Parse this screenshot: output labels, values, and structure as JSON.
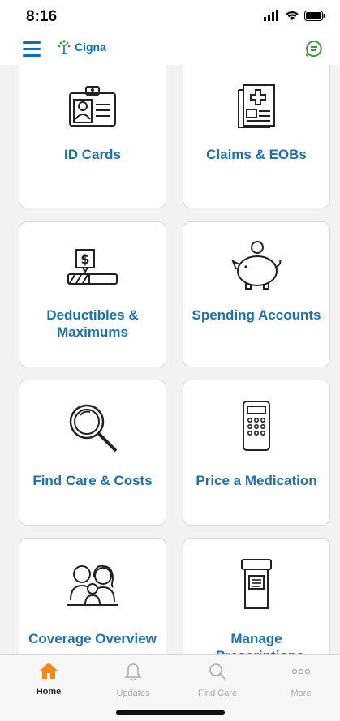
{
  "status": {
    "time": "8:16"
  },
  "header": {
    "brand": "Cigna"
  },
  "tiles": [
    {
      "label": "ID Cards",
      "icon": "id-card-icon"
    },
    {
      "label": "Claims & EOBs",
      "icon": "claims-document-icon"
    },
    {
      "label": "Deductibles & Maximums",
      "icon": "deductible-meter-icon"
    },
    {
      "label": "Spending Accounts",
      "icon": "piggy-bank-icon"
    },
    {
      "label": "Find Care & Costs",
      "icon": "magnifier-icon"
    },
    {
      "label": "Price a Medication",
      "icon": "calculator-icon"
    },
    {
      "label": "Coverage Overview",
      "icon": "family-icon"
    },
    {
      "label": "Manage Prescriptions",
      "icon": "pill-bottle-icon"
    }
  ],
  "tabbar": {
    "items": [
      {
        "label": "Home",
        "icon": "home-icon",
        "active": true
      },
      {
        "label": "Updates",
        "icon": "bell-icon",
        "active": false
      },
      {
        "label": "Find Care",
        "icon": "search-icon",
        "active": false
      },
      {
        "label": "More",
        "icon": "more-dots-icon",
        "active": false
      }
    ]
  },
  "colors": {
    "brand_blue": "#1e6fb0",
    "brand_green": "#3d9b35",
    "active_tab": "#f28a1b"
  }
}
